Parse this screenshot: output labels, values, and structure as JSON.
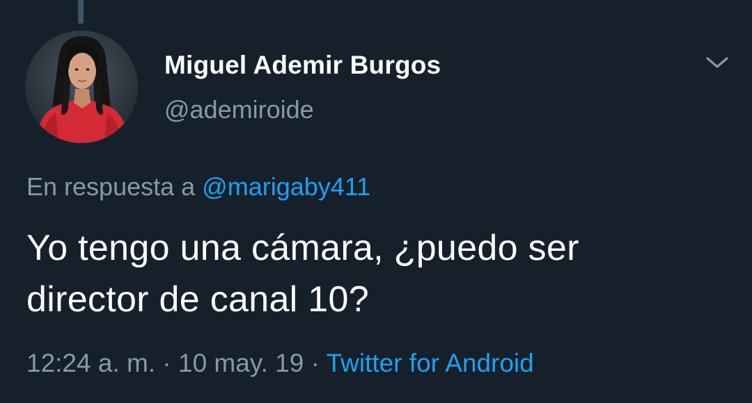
{
  "tweet": {
    "author": {
      "name": "Miguel Ademir Burgos",
      "handle": "@ademiroide"
    },
    "reply": {
      "prefix": "En respuesta a",
      "mention": "@marigaby411"
    },
    "text_lines": [
      "Yo tengo una cámara, ¿puedo ser",
      "director de canal 10?"
    ],
    "meta": {
      "time": "12:24 a. m.",
      "separator": "·",
      "date": "10 may. 19",
      "source": "Twitter for Android"
    }
  },
  "icons": {
    "menu": "chevron-down-icon",
    "avatar": "avatar"
  },
  "colors": {
    "background": "#15202b",
    "primary_text": "#ffffff",
    "secondary_text": "#8899a6",
    "link": "#1da1f2",
    "thread_line": "#3d5466"
  }
}
